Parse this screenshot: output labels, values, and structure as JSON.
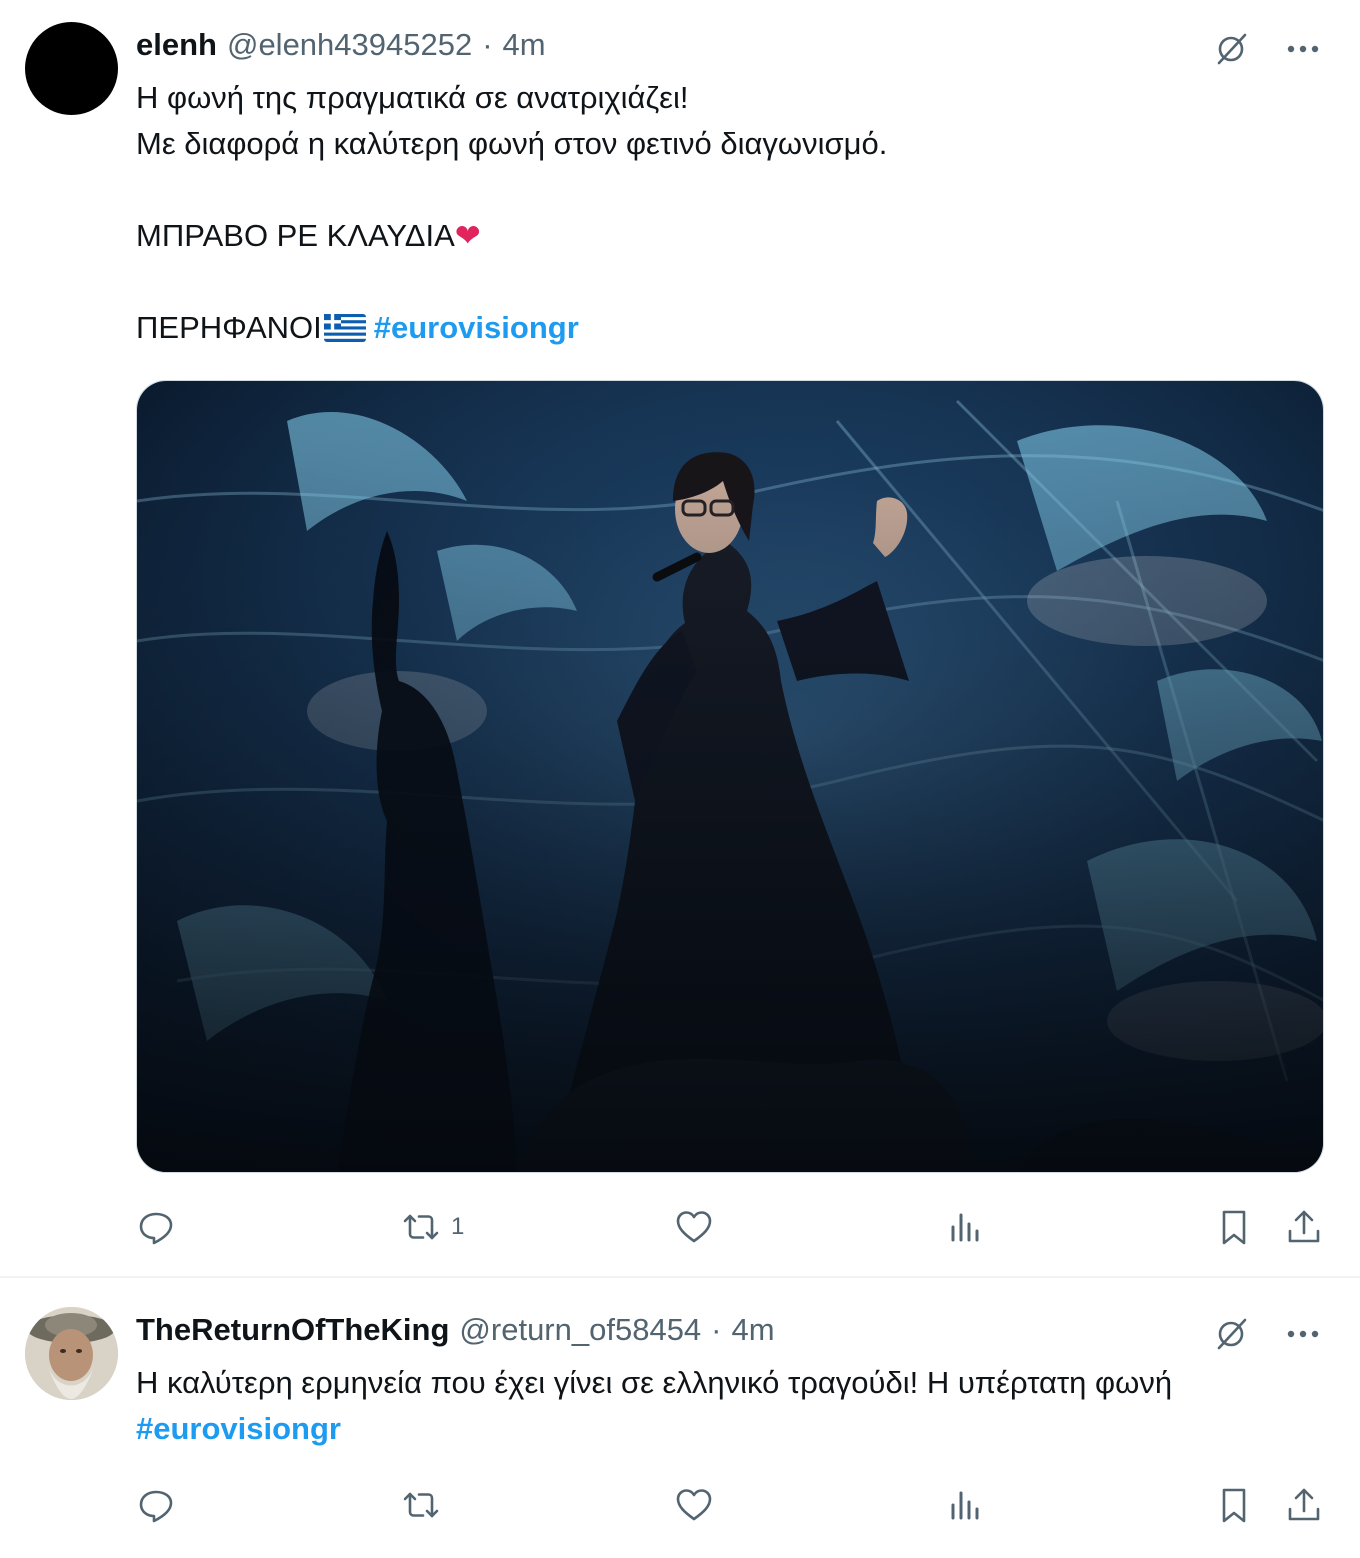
{
  "tweets": [
    {
      "author": {
        "name": "elenh",
        "handle": "@elenh43945252",
        "time": "4m"
      },
      "text": {
        "line1": "Η φωνή της πραγματικά σε ανατριχιάζει!",
        "line2": "Με διαφορά η καλύτερη φωνή στον φετινό διαγωνισμό.",
        "line3": "ΜΠΡΑΒΟ ΡΕ ΚΛΑΥΔΙΑ",
        "line3_emoji": "❤",
        "line4": "ΠΕΡΗΦΑΝΟΙ",
        "hashtag": "#eurovisiongr"
      },
      "actions": {
        "replies": "",
        "retweets": "1",
        "likes": "",
        "views": ""
      }
    },
    {
      "author": {
        "name": "TheReturnOfTheKing",
        "handle": "@return_of58454",
        "time": "4m"
      },
      "text": {
        "line1": "Η καλύτερη ερμηνεία που έχει γίνει σε ελληνικό τραγούδι! Η υπέρτατη φωνή",
        "hashtag": "#eurovisiongr"
      },
      "actions": {
        "replies": "",
        "retweets": "",
        "likes": "",
        "views": ""
      }
    }
  ],
  "separator": "·",
  "icons": {
    "grok": "grok-slash-icon",
    "more": "more-dots-icon",
    "reply": "reply-bubble-icon",
    "retweet": "retweet-arrows-icon",
    "like": "heart-outline-icon",
    "views": "bar-chart-icon",
    "bookmark": "bookmark-icon",
    "share": "share-upload-icon",
    "flag": "greek-flag-icon"
  },
  "colors": {
    "text": "#0f1419",
    "muted": "#536471",
    "accent": "#1d9bf0",
    "heart": "#e0245e"
  }
}
